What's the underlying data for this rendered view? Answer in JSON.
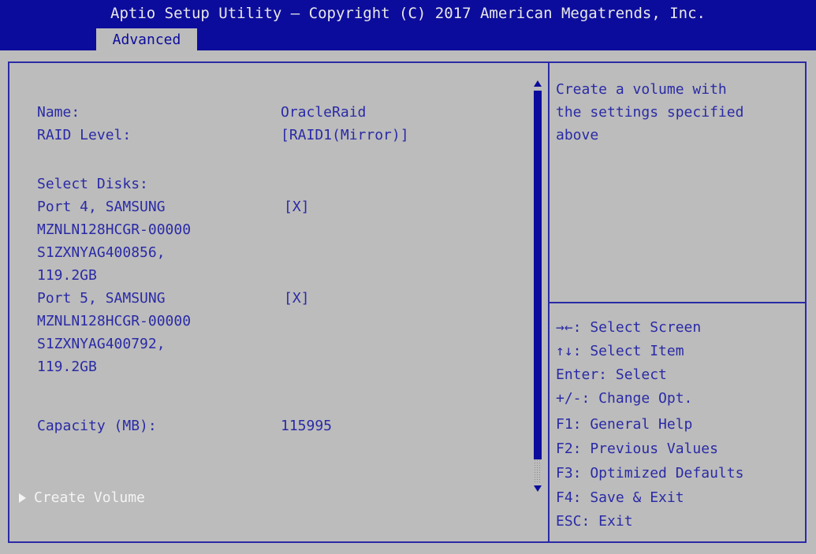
{
  "header": {
    "title": "Aptio Setup Utility – Copyright (C) 2017 American Megatrends, Inc.",
    "tabs": [
      {
        "label": "Advanced",
        "active": true
      }
    ]
  },
  "settings": {
    "name": {
      "label": "Name:",
      "value": "OracleRaid"
    },
    "raid_level": {
      "label": "RAID Level:",
      "value": "[RAID1(Mirror)]"
    },
    "select_disks_label": "Select Disks:",
    "disks": [
      {
        "lines": [
          "Port 4, SAMSUNG",
          "MZNLN128HCGR-00000",
          "S1ZXNYAG400856,",
          "119.2GB"
        ],
        "value": "[X]"
      },
      {
        "lines": [
          "Port 5, SAMSUNG",
          "MZNLN128HCGR-00000",
          "S1ZXNYAG400792,",
          "119.2GB"
        ],
        "value": "[X]"
      }
    ],
    "capacity": {
      "label": "Capacity (MB):",
      "value": "115995"
    },
    "create_volume": "Create Volume"
  },
  "help": {
    "description": [
      "Create a volume with",
      "the settings specified",
      "above"
    ],
    "keys": [
      "→←: Select Screen",
      "↑↓: Select Item",
      "Enter: Select",
      "+/-: Change Opt.",
      "F1: General Help",
      "F2: Previous Values",
      "F3: Optimized Defaults",
      "F4: Save & Exit",
      "ESC: Exit"
    ]
  },
  "colors": {
    "header_bg": "#0c0c9c",
    "body_bg": "#bcbcbc",
    "text": "#2a2aa6",
    "highlight": "#f4f4f4"
  }
}
